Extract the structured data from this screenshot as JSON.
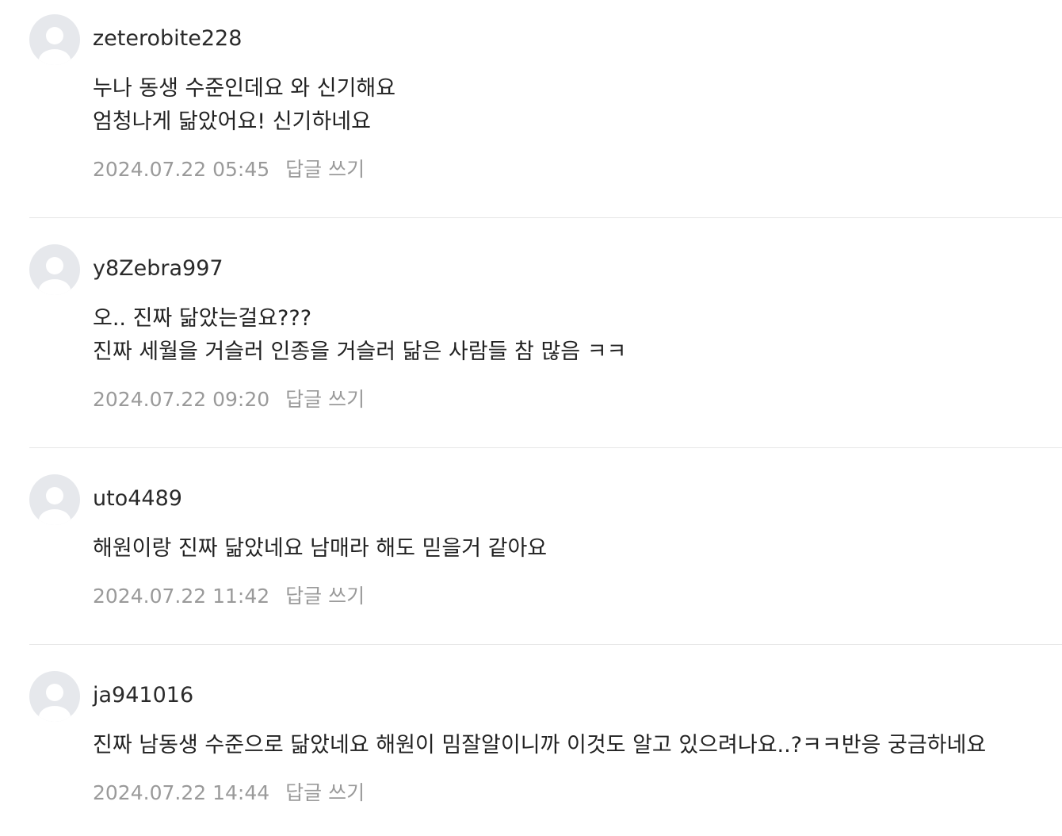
{
  "comments": [
    {
      "username": "zeterobite228",
      "lines": [
        "누나 동생 수준인데요 와 신기해요",
        "엄청나게 닮았어요! 신기하네요"
      ],
      "timestamp": "2024.07.22 05:45",
      "reply_label": "답글 쓰기"
    },
    {
      "username": "y8Zebra997",
      "lines": [
        "오.. 진짜 닮았는걸요???",
        "진짜 세월을 거슬러 인종을 거슬러 닮은 사람들 참 많음 ㅋㅋ"
      ],
      "timestamp": "2024.07.22 09:20",
      "reply_label": "답글 쓰기"
    },
    {
      "username": "uto4489",
      "lines": [
        "해원이랑 진짜 닮았네요 남매라 해도 믿을거 같아요"
      ],
      "timestamp": "2024.07.22 11:42",
      "reply_label": "답글 쓰기"
    },
    {
      "username": "ja941016",
      "lines": [
        "진짜 남동생 수준으로 닮았네요 해원이 밈잘알이니까 이것도 알고 있으려나요..?ㅋㅋ반응 궁금하네요"
      ],
      "timestamp": "2024.07.22 14:44",
      "reply_label": "답글 쓰기"
    }
  ]
}
